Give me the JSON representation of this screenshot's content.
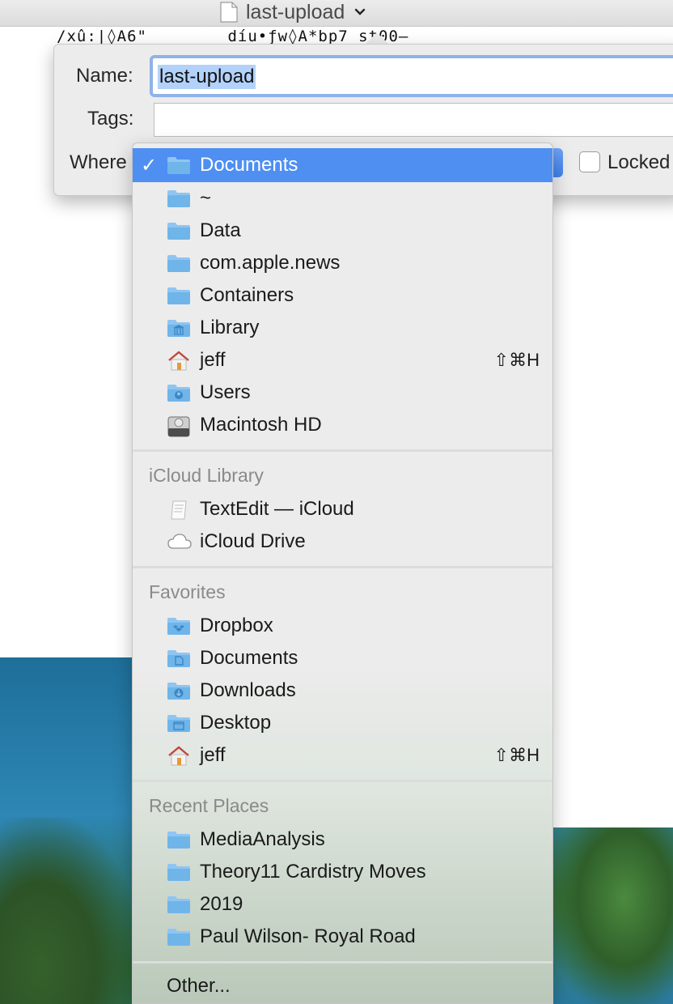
{
  "window": {
    "title": "last-upload",
    "garbled_text": "/xû:|◊A6\"        díu•ƒw◊A*bp7 st00–"
  },
  "save_sheet": {
    "name_label": "Name:",
    "name_value": "last-upload",
    "tags_label": "Tags:",
    "tags_value": "",
    "where_label": "Where",
    "locked_label": "Locked"
  },
  "where_menu": {
    "selected": "Documents",
    "location_items": [
      {
        "label": "Documents",
        "icon": "folder-icon",
        "selected": true
      },
      {
        "label": "~",
        "icon": "folder-icon"
      },
      {
        "label": "Data",
        "icon": "folder-icon"
      },
      {
        "label": "com.apple.news",
        "icon": "folder-icon"
      },
      {
        "label": "Containers",
        "icon": "folder-icon"
      },
      {
        "label": "Library",
        "icon": "library-folder-icon"
      },
      {
        "label": "jeff",
        "icon": "home-icon",
        "shortcut": "⇧⌘H"
      },
      {
        "label": "Users",
        "icon": "users-folder-icon"
      },
      {
        "label": "Macintosh HD",
        "icon": "hard-drive-icon"
      }
    ],
    "icloud_section": "iCloud Library",
    "icloud_items": [
      {
        "label": "TextEdit — iCloud",
        "icon": "textedit-icon"
      },
      {
        "label": "iCloud Drive",
        "icon": "cloud-icon"
      }
    ],
    "favorites_section": "Favorites",
    "favorites_items": [
      {
        "label": "Dropbox",
        "icon": "dropbox-folder-icon"
      },
      {
        "label": "Documents",
        "icon": "documents-folder-icon"
      },
      {
        "label": "Downloads",
        "icon": "downloads-folder-icon"
      },
      {
        "label": "Desktop",
        "icon": "desktop-folder-icon"
      },
      {
        "label": "jeff",
        "icon": "home-icon",
        "shortcut": "⇧⌘H"
      }
    ],
    "recent_section": "Recent Places",
    "recent_items": [
      {
        "label": "MediaAnalysis",
        "icon": "folder-icon"
      },
      {
        "label": "Theory11 Cardistry Moves",
        "icon": "folder-icon"
      },
      {
        "label": "2019",
        "icon": "folder-icon"
      },
      {
        "label": "Paul Wilson- Royal Road",
        "icon": "folder-icon"
      }
    ],
    "other_label": "Other..."
  },
  "colors": {
    "selection": "#4f8ff2",
    "folder": "#6fb5ea",
    "menu_bg": "#ececec"
  }
}
